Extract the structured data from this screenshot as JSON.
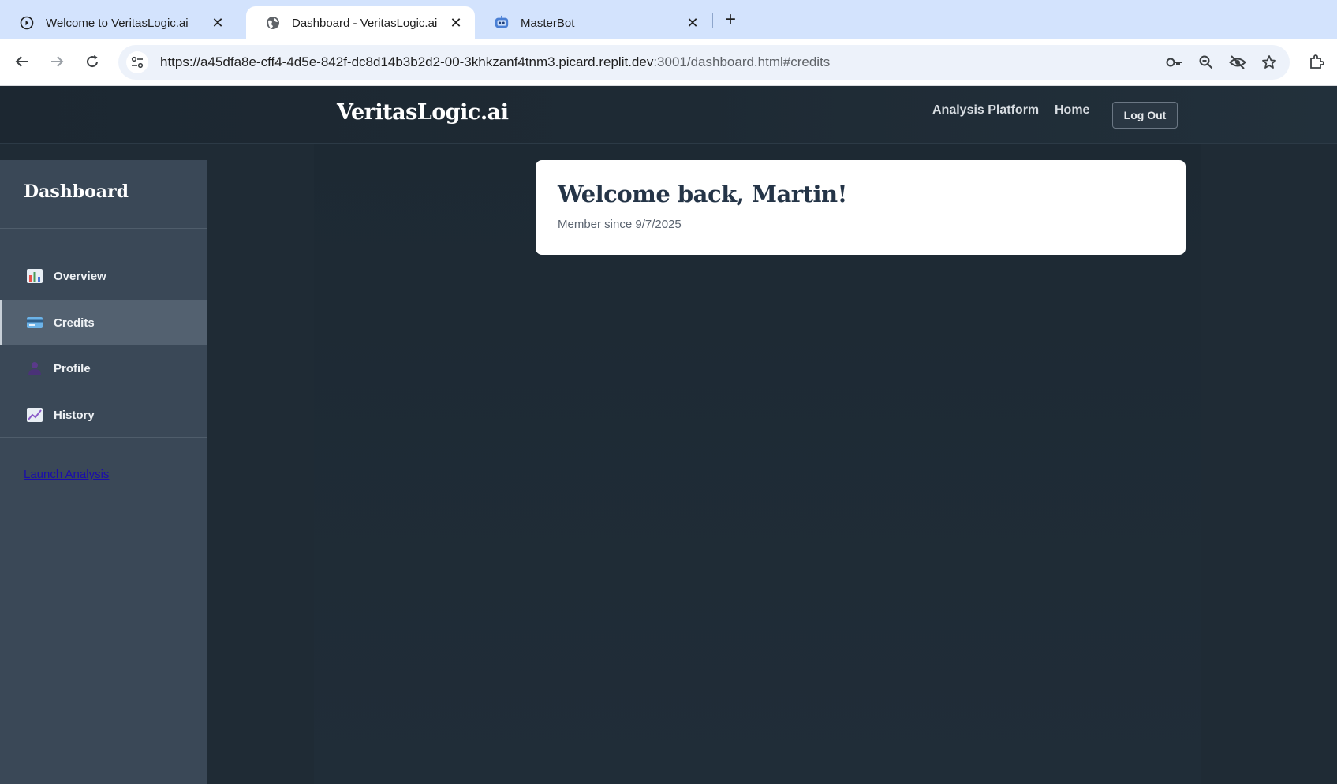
{
  "browser": {
    "tabs": [
      {
        "title": "Welcome to VeritasLogic.ai",
        "icon": "play-circle-icon",
        "active": false
      },
      {
        "title": "Dashboard - VeritasLogic.ai",
        "icon": "globe-icon",
        "active": true
      },
      {
        "title": "MasterBot",
        "icon": "robot-icon",
        "active": false
      }
    ],
    "url_main": "https://a45dfa8e-cff4-4d5e-842f-dc8d14b3b2d2-00-3khkzanf4tnm3.picard.replit.dev",
    "url_rest": ":3001/dashboard.html#credits"
  },
  "header": {
    "brand": "VeritasLogic.ai",
    "nav": {
      "analysis_platform": "Analysis Platform",
      "home": "Home"
    },
    "logout_label": "Log Out"
  },
  "sidebar": {
    "title": "Dashboard",
    "items": [
      {
        "label": "Overview",
        "icon": "bar-chart-icon",
        "active": false
      },
      {
        "label": "Credits",
        "icon": "credit-card-icon",
        "active": true
      },
      {
        "label": "Profile",
        "icon": "user-icon",
        "active": false
      },
      {
        "label": "History",
        "icon": "trend-chart-icon",
        "active": false
      }
    ],
    "launch_link": "Launch Analysis"
  },
  "welcome": {
    "title": "Welcome back, Martin!",
    "subtitle": "Member since 9/7/2025"
  },
  "colors": {
    "tab_strip": "#d3e3fd",
    "page_bg": "#1f2b35",
    "sidebar_bg": "#3a4857",
    "sidebar_active": "#536170",
    "card_bg": "#ffffff",
    "title_text": "#243447",
    "link": "#1a0dab"
  }
}
